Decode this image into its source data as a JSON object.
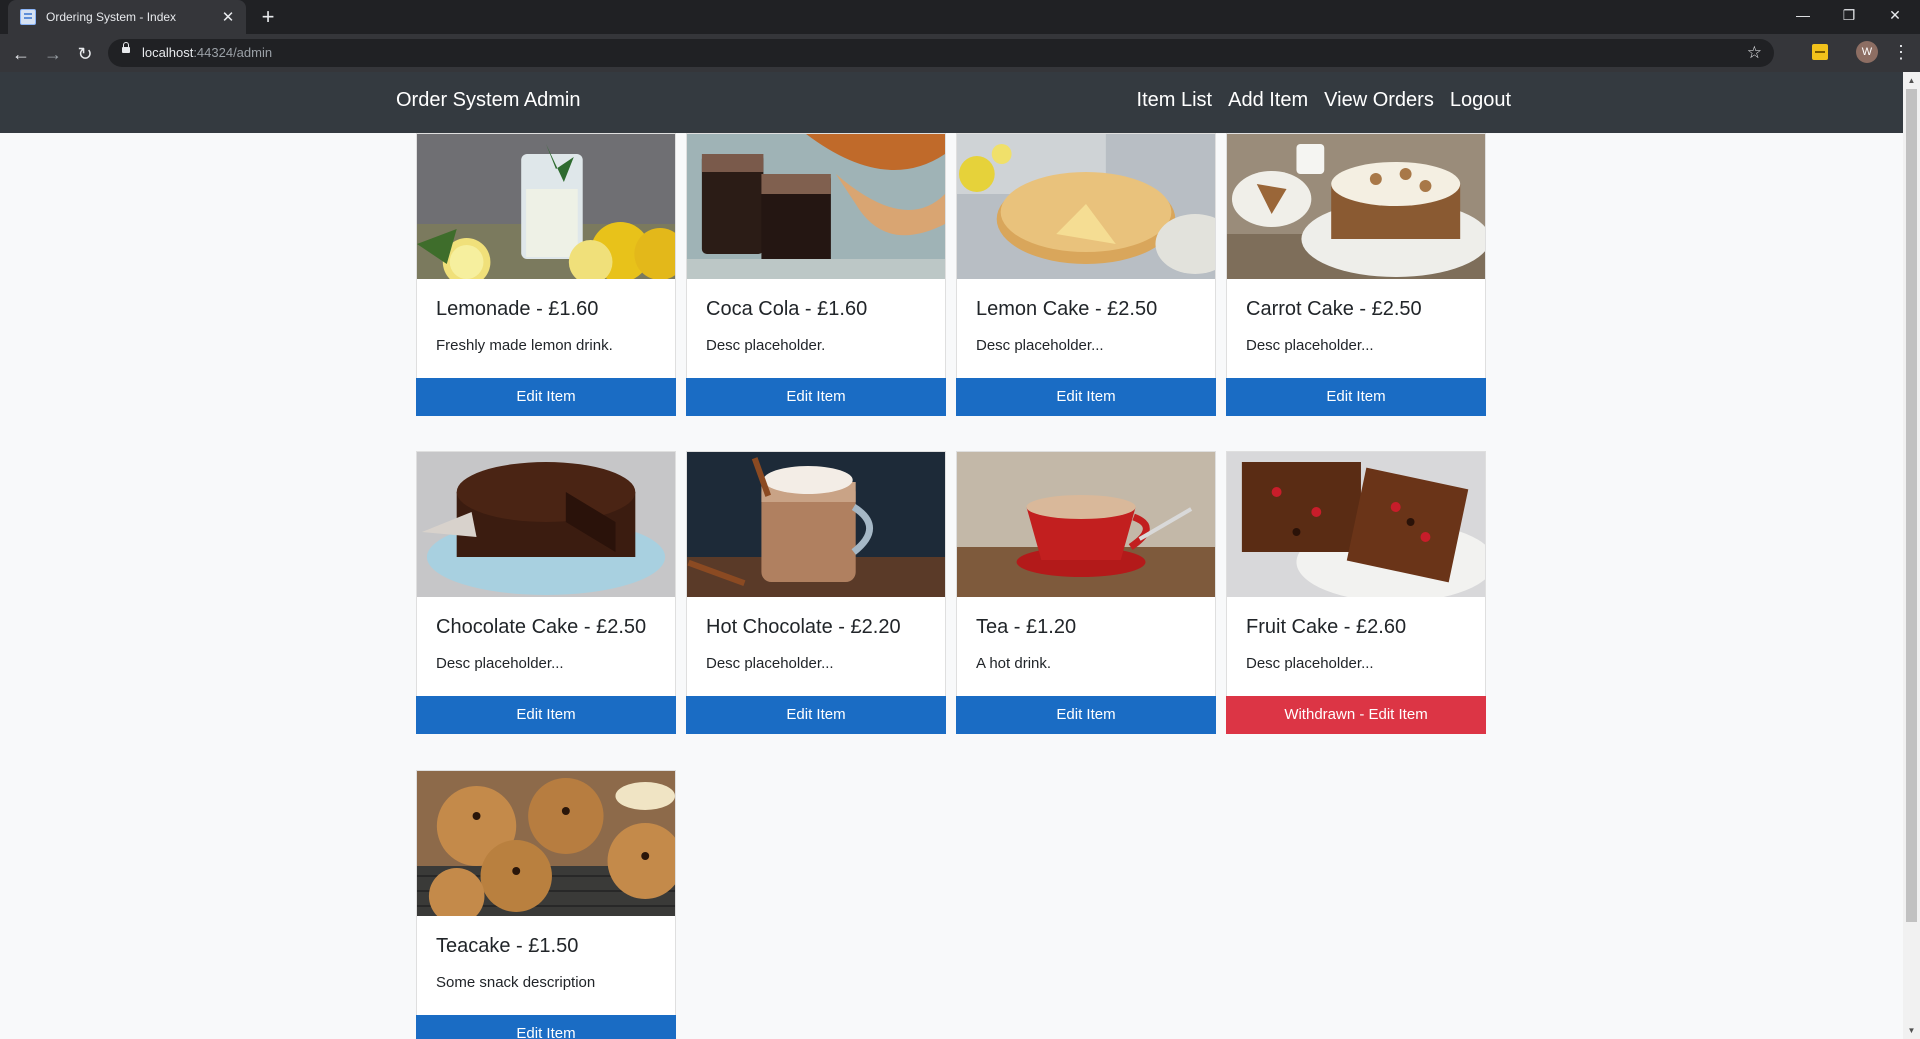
{
  "browser": {
    "tab_title": "Ordering System - Index",
    "url_host": "localhost",
    "url_rest": ":44324/admin",
    "avatar_letter": "W"
  },
  "navbar": {
    "brand": "Order System Admin",
    "links": [
      "Item List",
      "Add Item",
      "View Orders",
      "Logout"
    ]
  },
  "items": [
    {
      "title": "Lemonade - £1.60",
      "desc": "Freshly made lemon drink.",
      "button": "Edit Item",
      "status": "active",
      "image": "lemonade-photo"
    },
    {
      "title": "Coca Cola - £1.60",
      "desc": "Desc placeholder.",
      "button": "Edit Item",
      "status": "active",
      "image": "coca-cola-photo"
    },
    {
      "title": "Lemon Cake - £2.50",
      "desc": "Desc placeholder...",
      "button": "Edit Item",
      "status": "active",
      "image": "lemon-cake-photo"
    },
    {
      "title": "Carrot Cake - £2.50",
      "desc": "Desc placeholder...",
      "button": "Edit Item",
      "status": "active",
      "image": "carrot-cake-photo"
    },
    {
      "title": "Chocolate Cake - £2.50",
      "desc": "Desc placeholder...",
      "button": "Edit Item",
      "status": "active",
      "image": "chocolate-cake-photo"
    },
    {
      "title": "Hot Chocolate - £2.20",
      "desc": "Desc placeholder...",
      "button": "Edit Item",
      "status": "active",
      "image": "hot-chocolate-photo"
    },
    {
      "title": "Tea - £1.20",
      "desc": "A hot drink.",
      "button": "Edit Item",
      "status": "active",
      "image": "tea-photo"
    },
    {
      "title": "Fruit Cake - £2.60",
      "desc": "Desc placeholder...",
      "button": "Withdrawn - Edit Item",
      "status": "withdrawn",
      "image": "fruit-cake-photo"
    },
    {
      "title": "Teacake - £1.50",
      "desc": "Some snack description",
      "button": "Edit Item",
      "status": "active",
      "image": "teacake-photo"
    }
  ],
  "colors": {
    "navbar": "#343a40",
    "primary_button": "#1a6cc4",
    "danger_button": "#dc3545",
    "page_background": "#f8f9fa"
  }
}
